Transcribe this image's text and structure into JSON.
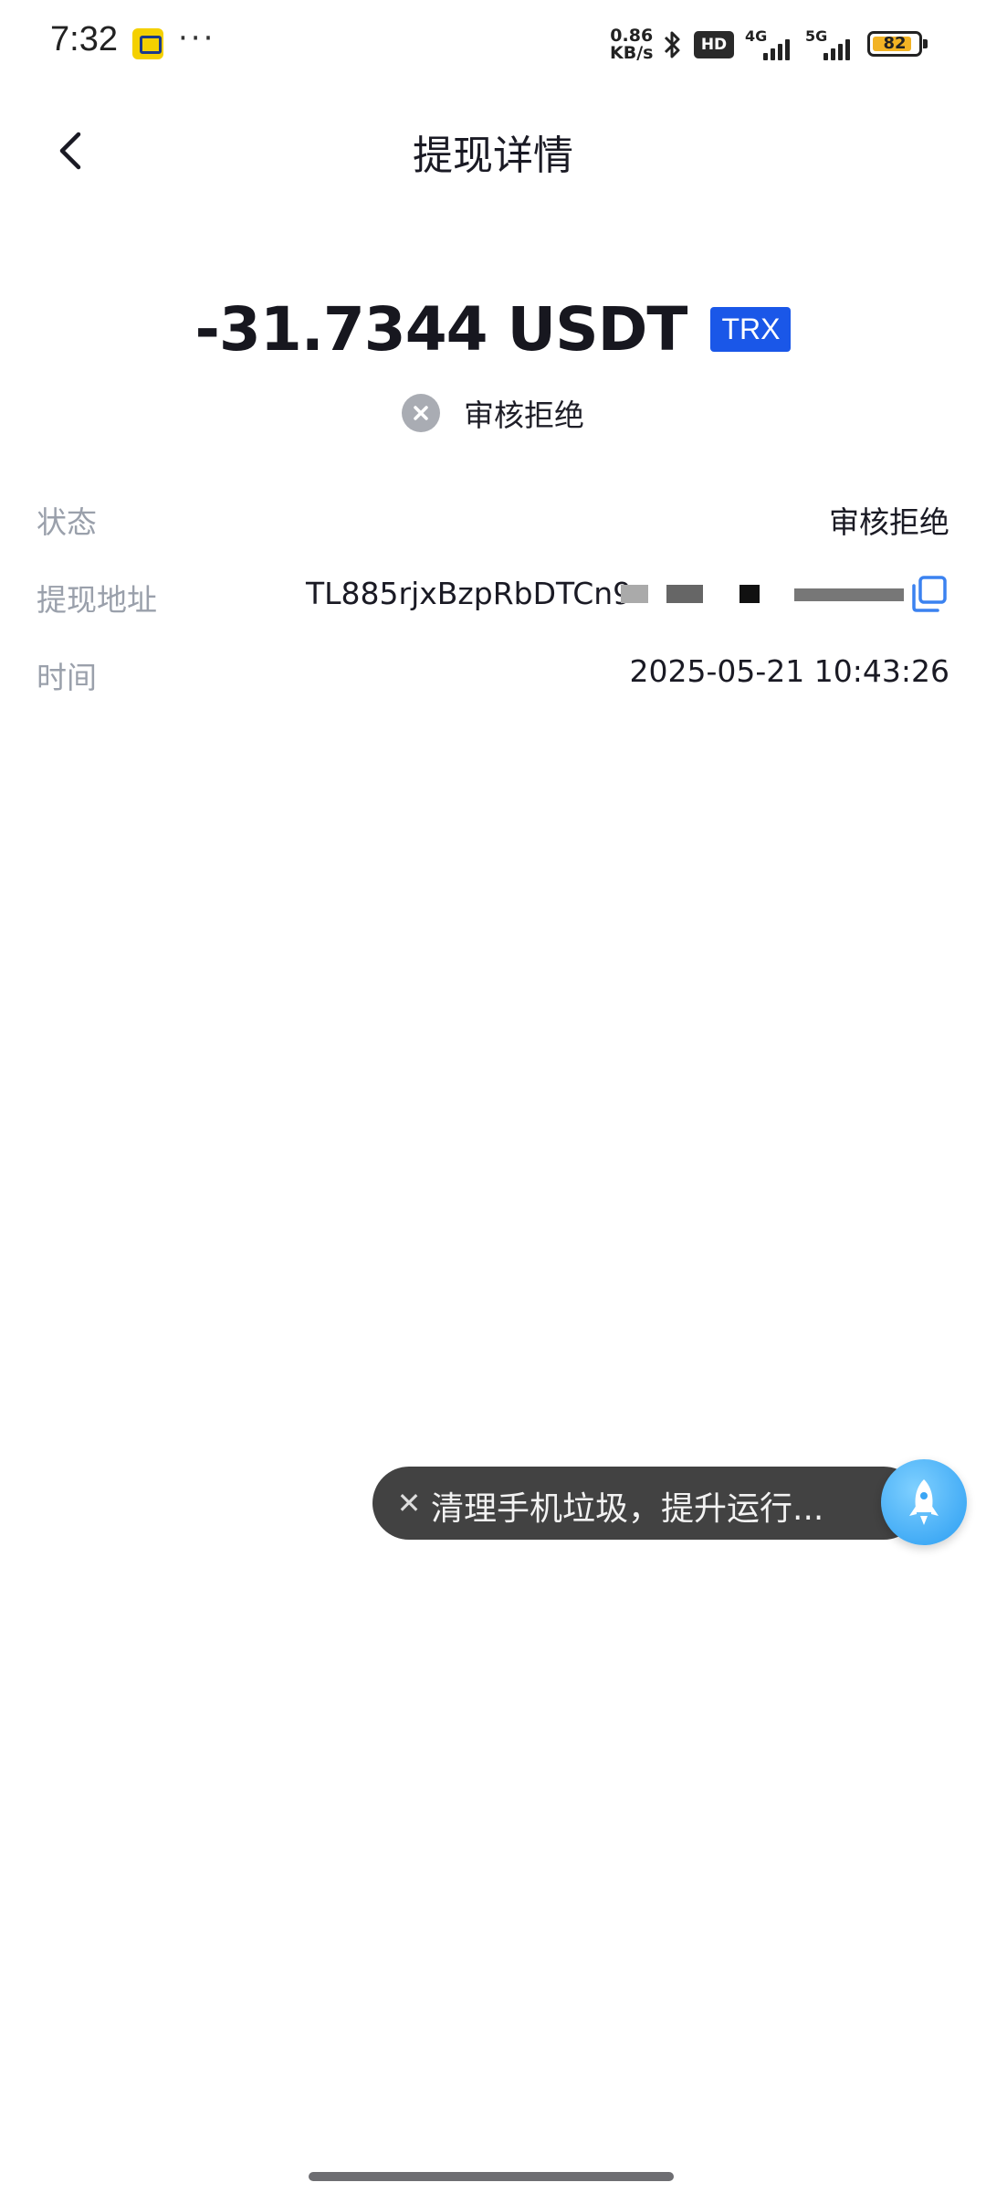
{
  "status_bar": {
    "time": "7:32",
    "more_indicator": "···",
    "net_speed_value": "0.86",
    "net_speed_unit": "KB/s",
    "hd_label": "HD",
    "network_1": "4G",
    "network_2": "5G",
    "battery_level": "82",
    "icons": [
      "app-notification-icon",
      "bluetooth-icon",
      "signal-icon",
      "battery-icon"
    ]
  },
  "header": {
    "title": "提现详情",
    "back_icon": "chevron-left-icon"
  },
  "summary": {
    "amount": "-31.7344 USDT",
    "network_badge": "TRX",
    "status_icon": "close-circle-icon",
    "status_text": "审核拒绝",
    "badge_color": "#1a57e8"
  },
  "details": {
    "status_label": "状态",
    "status_value": "审核拒绝",
    "address_label": "提现地址",
    "address_value": "TL885rjxBzpRbDTCn9",
    "address_icon": "copy-icon",
    "time_label": "时间",
    "time_value": "2025-05-21 10:43:26"
  },
  "toast": {
    "close_icon": "close-icon",
    "text": "清理手机垃圾，提升运行...",
    "action_icon": "rocket-icon"
  }
}
